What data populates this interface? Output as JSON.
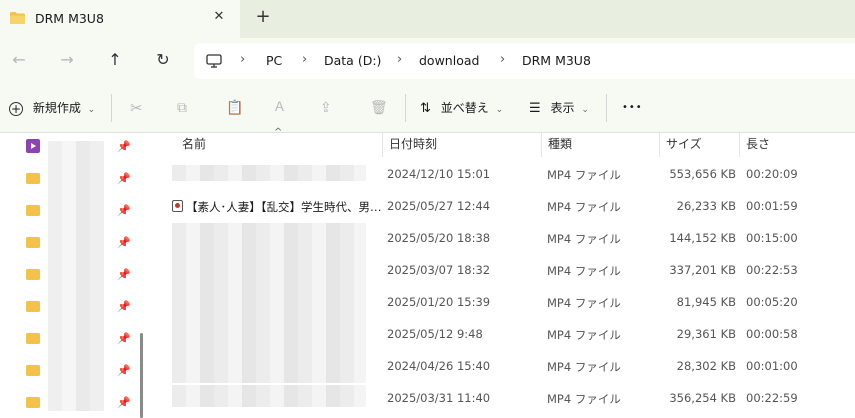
{
  "tab": {
    "title": "DRM M3U8",
    "close_glyph": "✕",
    "new_glyph": "+"
  },
  "nav": {
    "back": "←",
    "forward": "→",
    "up": "↑",
    "refresh": "↻"
  },
  "breadcrumb": [
    "PC",
    "Data (D:)",
    "download",
    "DRM M3U8"
  ],
  "toolbar": {
    "new_label": "新規作成",
    "sort_label": "並べ替え",
    "view_label": "表示",
    "more": "•••"
  },
  "columns": {
    "name": "名前",
    "date": "日付時刻",
    "type": "種類",
    "size": "サイズ",
    "length": "長さ"
  },
  "rows": [
    {
      "name": "",
      "date": "2024/12/10 15:01",
      "type": "MP4 ファイル",
      "size": "553,656 KB",
      "length": "00:20:09"
    },
    {
      "name": "【素人･人妻】【乱交】学生時代、男…",
      "date": "2025/05/27 12:44",
      "type": "MP4 ファイル",
      "size": "26,233 KB",
      "length": "00:01:59"
    },
    {
      "name": "",
      "date": "2025/05/20 18:38",
      "type": "MP4 ファイル",
      "size": "144,152 KB",
      "length": "00:15:00"
    },
    {
      "name": "",
      "date": "2025/03/07 18:32",
      "type": "MP4 ファイル",
      "size": "337,201 KB",
      "length": "00:22:53"
    },
    {
      "name": "",
      "date": "2025/01/20 15:39",
      "type": "MP4 ファイル",
      "size": "81,945 KB",
      "length": "00:05:20"
    },
    {
      "name": "",
      "date": "2025/05/12 9:48",
      "type": "MP4 ファイル",
      "size": "29,361 KB",
      "length": "00:00:58"
    },
    {
      "name": "",
      "date": "2024/04/26 15:40",
      "type": "MP4 ファイル",
      "size": "28,302 KB",
      "length": "00:01:00"
    },
    {
      "name": "",
      "date": "2025/03/31 11:40",
      "type": "MP4 ファイル",
      "size": "356,254 KB",
      "length": "00:22:59"
    }
  ],
  "colors": {
    "folder": "#f2c24d",
    "tabbar_bg": "#e8eee0",
    "toolbar_bg": "#f7f9f3"
  }
}
